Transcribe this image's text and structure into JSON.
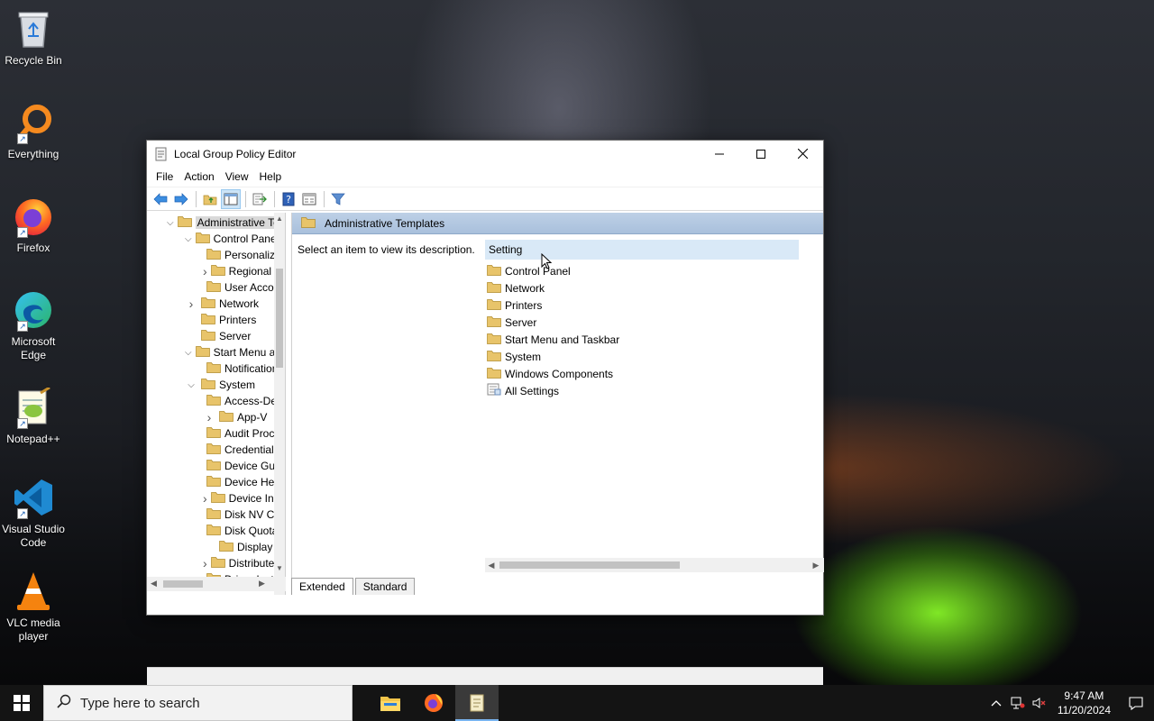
{
  "desktop": {
    "icons": [
      {
        "label": "Recycle Bin"
      },
      {
        "label": "Everything"
      },
      {
        "label": "Firefox"
      },
      {
        "label": "Microsoft Edge"
      },
      {
        "label": "Notepad++"
      },
      {
        "label": "Visual Studio Code"
      },
      {
        "label": "VLC media player"
      }
    ]
  },
  "window": {
    "title": "Local Group Policy Editor",
    "menu": [
      "File",
      "Action",
      "View",
      "Help"
    ],
    "tree": [
      {
        "label": "Administrative Templates",
        "level": 0,
        "expander": "open",
        "selected": true
      },
      {
        "label": "Control Panel",
        "level": 1,
        "expander": "open"
      },
      {
        "label": "Personalization",
        "level": 2,
        "expander": "none"
      },
      {
        "label": "Regional and Language Options",
        "level": 2,
        "expander": "closed"
      },
      {
        "label": "User Accounts",
        "level": 2,
        "expander": "none"
      },
      {
        "label": "Network",
        "level": 1,
        "expander": "closed"
      },
      {
        "label": "Printers",
        "level": 1,
        "expander": "none"
      },
      {
        "label": "Server",
        "level": 1,
        "expander": "none"
      },
      {
        "label": "Start Menu and Taskbar",
        "level": 1,
        "expander": "open"
      },
      {
        "label": "Notifications",
        "level": 2,
        "expander": "none"
      },
      {
        "label": "System",
        "level": 1,
        "expander": "open"
      },
      {
        "label": "Access-Denied Assistance",
        "level": 2,
        "expander": "none"
      },
      {
        "label": "App-V",
        "level": 2,
        "expander": "closed"
      },
      {
        "label": "Audit Process Creation",
        "level": 2,
        "expander": "none"
      },
      {
        "label": "Credentials Delegation",
        "level": 2,
        "expander": "none"
      },
      {
        "label": "Device Guard",
        "level": 2,
        "expander": "none"
      },
      {
        "label": "Device Health Attestation Service",
        "level": 2,
        "expander": "none"
      },
      {
        "label": "Device Installation",
        "level": 2,
        "expander": "closed"
      },
      {
        "label": "Disk NV Cache",
        "level": 2,
        "expander": "none"
      },
      {
        "label": "Disk Quotas",
        "level": 2,
        "expander": "none"
      },
      {
        "label": "Display",
        "level": 2,
        "expander": "none"
      },
      {
        "label": "Distributed COM",
        "level": 2,
        "expander": "closed"
      },
      {
        "label": "Driver Installation",
        "level": 2,
        "expander": "none"
      }
    ],
    "pane_header": "Administrative Templates",
    "description": "Select an item to view its description.",
    "list_header": "Setting",
    "list_items": [
      {
        "label": "Control Panel",
        "icon": "folder"
      },
      {
        "label": "Network",
        "icon": "folder"
      },
      {
        "label": "Printers",
        "icon": "folder"
      },
      {
        "label": "Server",
        "icon": "folder"
      },
      {
        "label": "Start Menu and Taskbar",
        "icon": "folder"
      },
      {
        "label": "System",
        "icon": "folder"
      },
      {
        "label": "Windows Components",
        "icon": "folder"
      },
      {
        "label": "All Settings",
        "icon": "settings-list"
      }
    ],
    "tabs": [
      {
        "label": "Extended",
        "active": true
      },
      {
        "label": "Standard",
        "active": false
      }
    ]
  },
  "taskbar": {
    "search_placeholder": "Type here to search",
    "time": "9:47 AM",
    "date": "11/20/2024"
  },
  "colors": {
    "pane_header": "#a9c0dc",
    "list_header": "#d9e9f7",
    "folder": "#e8c46a",
    "taskbar": "#141414"
  }
}
